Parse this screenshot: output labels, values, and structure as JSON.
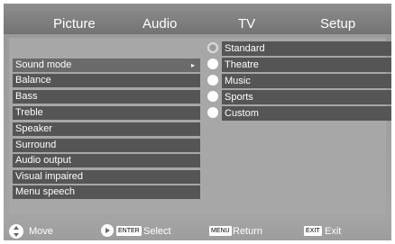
{
  "tabs": [
    "Picture",
    "Audio",
    "TV",
    "Setup"
  ],
  "menu": [
    {
      "label": "Sound mode",
      "selected": true
    },
    {
      "label": "Balance"
    },
    {
      "label": "Bass"
    },
    {
      "label": "Treble"
    },
    {
      "label": "Speaker"
    },
    {
      "label": "Surround"
    },
    {
      "label": "Audio output"
    },
    {
      "label": "Visual impaired"
    },
    {
      "label": "Menu speech"
    }
  ],
  "submenu_arrow": "▸",
  "options": [
    {
      "label": "Standard",
      "checked": true
    },
    {
      "label": "Theatre"
    },
    {
      "label": "Music"
    },
    {
      "label": "Sports"
    },
    {
      "label": "Custom"
    }
  ],
  "footer": {
    "move": "Move",
    "enter_key": "ENTER",
    "select": "Select",
    "menu_key": "MENU",
    "return": "Return",
    "exit_key": "EXIT",
    "exit": "Exit"
  }
}
